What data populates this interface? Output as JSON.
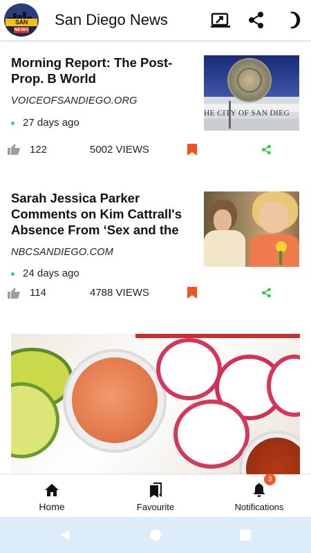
{
  "app": {
    "title": "San Diego News",
    "logo_text_top": "SAN DIEGO",
    "logo_text_bottom": "NEWS"
  },
  "toolbar": {
    "icons": [
      "cast-icon",
      "share-icon",
      "dark-mode-icon"
    ]
  },
  "articles": [
    {
      "headline": "Morning Report: The Post-Prop. B World",
      "source": "VOICEOFSANDIEGO.ORG",
      "time": "27 days ago",
      "likes": "122",
      "views": "5002 VIEWS",
      "thumb_caption": "HE CITY OF SAN DIEG"
    },
    {
      "headline": "Sarah Jessica Parker Comments on Kim Cattrall's Absence From ‘Sex and the",
      "source": "NBCSANDIEGO.COM",
      "time": "24 days ago",
      "likes": "114",
      "views": "4788 VIEWS"
    }
  ],
  "bottom_nav": {
    "home": "Home",
    "favourite": "Favourite",
    "notifications": "Notifications",
    "notification_count": "3"
  },
  "colors": {
    "bookmark": "#f4511e",
    "share": "#2ecc40",
    "dot": "#2ec4c9",
    "badge": "#f05a28",
    "system_nav": "#dcecf8"
  }
}
